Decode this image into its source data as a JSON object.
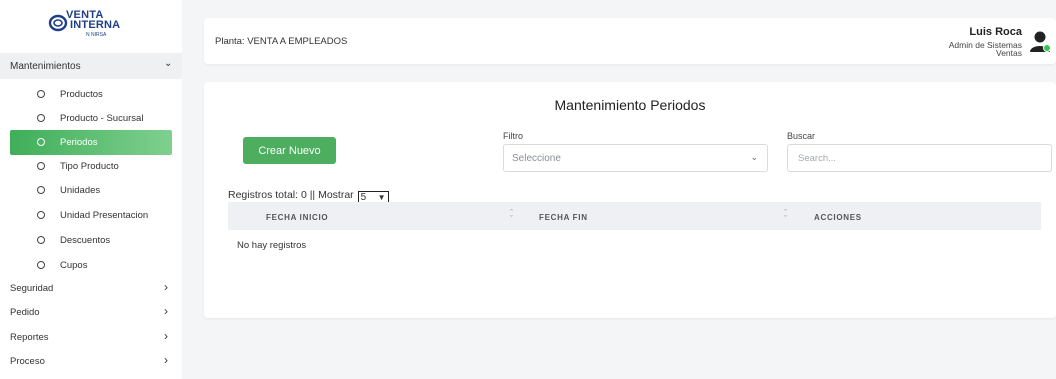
{
  "brand": {
    "line1": "VENTA",
    "line2": "INTERNA",
    "line3": "N NIRSA",
    "color": "#1f3f86"
  },
  "sidebar": {
    "section_title": "Mantenimientos",
    "items": [
      {
        "label": "Productos"
      },
      {
        "label": "Producto - Sucursal"
      },
      {
        "label": "Periodos",
        "active": true
      },
      {
        "label": "Tipo Producto"
      },
      {
        "label": "Unidades"
      },
      {
        "label": "Unidad Presentacion"
      },
      {
        "label": "Descuentos"
      },
      {
        "label": "Cupos"
      }
    ],
    "sections": [
      {
        "label": "Seguridad"
      },
      {
        "label": "Pedido"
      },
      {
        "label": "Reportes"
      },
      {
        "label": "Proceso"
      }
    ],
    "active_color": "#4cae5e"
  },
  "header": {
    "planta": "Planta: VENTA A EMPLEADOS",
    "user_name": "Luis Roca",
    "user_role": "Admin de Sistemas",
    "user_dept": "Ventas",
    "avatar_icon": "user-avatar-icon",
    "status_color": "#35c34d"
  },
  "main": {
    "title": "Mantenimiento Periodos",
    "create_button": "Crear Nuevo",
    "filter_label": "Filtro",
    "filter_value": "Seleccione",
    "search_label": "Buscar",
    "search_placeholder": "Search...",
    "records_text": "Registros total: 0 || Mostrar",
    "page_size": "5",
    "columns": [
      "FECHA INICIO",
      "FECHA FIN",
      "ACCIONES"
    ],
    "empty_text": "No hay registros"
  }
}
